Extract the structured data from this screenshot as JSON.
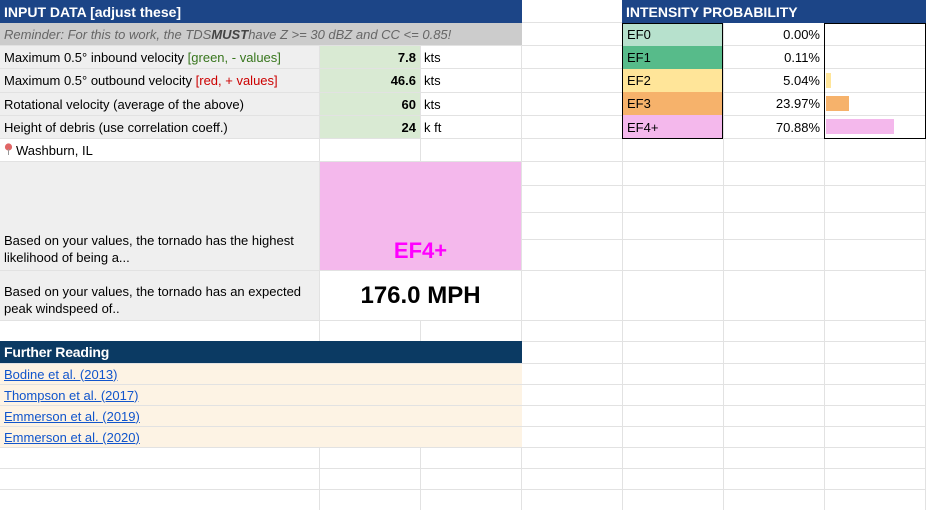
{
  "input": {
    "header": "INPUT DATA [adjust these]",
    "reminder_pre": "Reminder: For this to work, the TDS ",
    "reminder_bold": "MUST",
    "reminder_post": " have Z >= 30 dBZ and CC <= 0.85!",
    "rows": [
      {
        "label": "Maximum 0.5° inbound velocity ",
        "hint": "[green, - values]",
        "value": "7.8",
        "unit": "kts"
      },
      {
        "label": "Maximum 0.5° outbound velocity ",
        "hint": "[red, + values]",
        "value": "46.6",
        "unit": "kts"
      },
      {
        "label": "Rotational velocity (average of the above)",
        "hint": "",
        "value": "60",
        "unit": "kts"
      },
      {
        "label": "Height of debris (use correlation coeff.)",
        "hint": "",
        "value": "24",
        "unit": "k ft"
      }
    ]
  },
  "location": {
    "icon": "map-pin-icon",
    "name": "Washburn, IL"
  },
  "results": {
    "likelihood_label": "Based on your values, the tornado has the highest likelihood of being a...",
    "likelihood_value": "EF4+",
    "windspeed_label": "Based on your values, the tornado has an expected peak windspeed of..",
    "windspeed_value": "176.0 MPH"
  },
  "probability": {
    "header": "INTENSITY PROBABILITY",
    "rows": [
      {
        "label": "EF0",
        "percent": "0.00%",
        "fraction": 0.0,
        "color": "#b7e1cd",
        "bar_color": "#fff2cc"
      },
      {
        "label": "EF1",
        "percent": "0.11%",
        "fraction": 0.0011,
        "color": "#57bb8a",
        "bar_color": "#fff2cc"
      },
      {
        "label": "EF2",
        "percent": "5.04%",
        "fraction": 0.0504,
        "color": "#ffe599",
        "bar_color": "#ffe599"
      },
      {
        "label": "EF3",
        "percent": "23.97%",
        "fraction": 0.2397,
        "color": "#f6b26b",
        "bar_color": "#f6b26b"
      },
      {
        "label": "EF4+",
        "percent": "70.88%",
        "fraction": 0.7088,
        "color": "#f4b8ec",
        "bar_color": "#f4b8ec"
      }
    ]
  },
  "reading": {
    "header": "Further Reading",
    "links": [
      "Bodine et al. (2013)",
      "Thompson et al. (2017)",
      "Emmerson et al. (2019)",
      "Emmerson et al. (2020)"
    ]
  }
}
